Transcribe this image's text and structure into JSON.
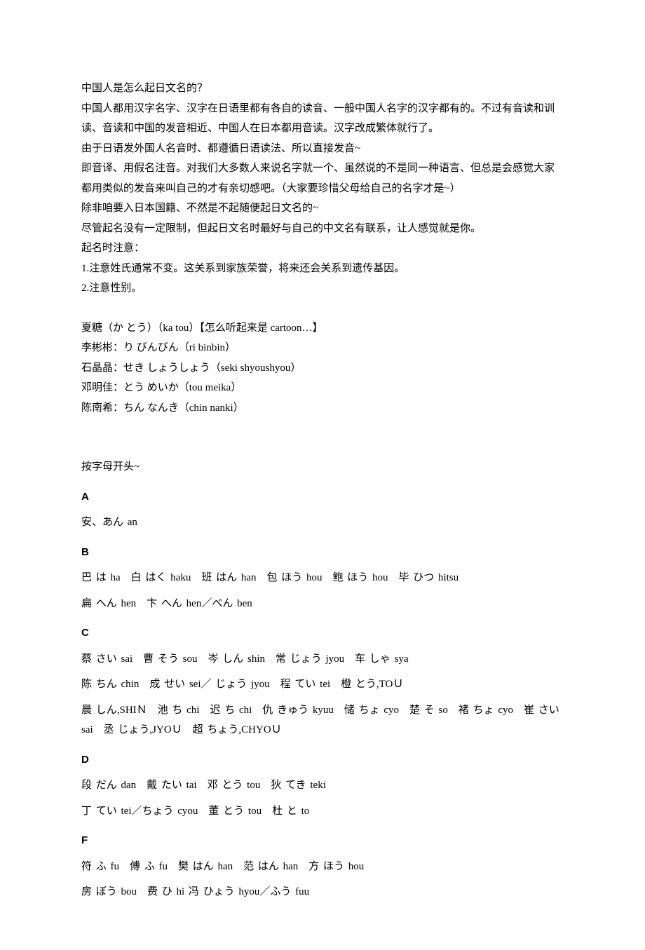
{
  "intro": {
    "lines": [
      "中国人是怎么起日文名的？",
      "中国人都用汉字名字、汉字在日语里都有各自的读音、一般中国人名字的汉字都有的。不过有音读和训读、音读和中国的发音相近、中国人在日本都用音读。汉字改成繁体就行了。",
      "由于日语发外国人名音时、都遵循日语读法、所以直接发音~",
      "即音译、用假名注音。对我们大多数人来说名字就一个、虽然说的不是同一种语言、但总是会感觉大家都用类似的发音来叫自己的才有亲切感吧。（大家要珍惜父母给自己的名字才是~）",
      "除非咱要入日本国籍、不然是不起随便起日文名的~",
      "尽管起名没有一定限制，但起日文名时最好与自己的中文名有联系，让人感觉就是你。",
      "起名时注意：",
      "1.注意姓氏通常不变。这关系到家族荣誉，将来还会关系到遗传基因。",
      "2.注意性别。"
    ]
  },
  "examples": {
    "lines": [
      "夏糖（か とう）（ka tou）【怎么听起来是 cartoon…】",
      "李彬彬：り びんびん（ri binbin）",
      "石晶晶：せき しょうしょう（seki shyoushyou）",
      "邓明佳：とう めいか（tou meika）",
      "陈南希：ちん なんき（chin nanki）"
    ]
  },
  "alpha_intro": "按字母开头~",
  "sections": {
    "A": {
      "label": "A",
      "lines": [
        "安、あん an"
      ]
    },
    "B": {
      "label": "B",
      "lines": [
        "巴 は ha　白 はく haku　班 はん han　包 ほう hou　鲍 ほう hou　毕 ひつ hitsu",
        "扁 へん hen　卞 へん hen／べん ben"
      ]
    },
    "C": {
      "label": "C",
      "lines": [
        "蔡 さい sai　曹 そう sou　岑 しん shin　常 じょう jyou　车 しゃ sya",
        "陈 ちん chin　成 せい sei／ じょう jyou　程 てい tei　橙 とう,TOＵ",
        "晨 しん,SHIＮ　池 ち chi　迟 ち chi　仇 きゅう kyuu　储 ちょ cyo　楚 そ so　褚 ちょ cyo　崔 さい sai　丞 じょう,JYOＵ　超 ちょう,CHYOＵ"
      ]
    },
    "D": {
      "label": "D",
      "lines": [
        "段 だん dan　戴 たい tai　邓 とう tou　狄 てき teki",
        "丁 てい tei／ちょう cyou　董 とう tou　杜 と to"
      ]
    },
    "F": {
      "label": "F",
      "lines": [
        "符 ふ fu　傅 ふ fu　樊 はん han　范 はん han　方 ほう hou",
        "房 ぼう bou　费 ひ hi 冯 ひょう hyou／ふう fuu"
      ]
    }
  }
}
